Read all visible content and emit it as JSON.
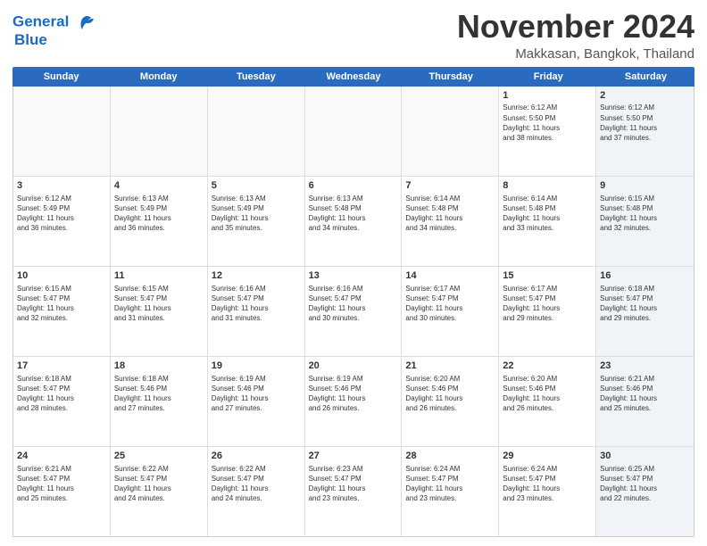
{
  "logo": {
    "line1": "General",
    "line2": "Blue"
  },
  "title": "November 2024",
  "location": "Makkasan, Bangkok, Thailand",
  "weekdays": [
    "Sunday",
    "Monday",
    "Tuesday",
    "Wednesday",
    "Thursday",
    "Friday",
    "Saturday"
  ],
  "weeks": [
    [
      {
        "day": "",
        "text": "",
        "empty": true
      },
      {
        "day": "",
        "text": "",
        "empty": true
      },
      {
        "day": "",
        "text": "",
        "empty": true
      },
      {
        "day": "",
        "text": "",
        "empty": true
      },
      {
        "day": "",
        "text": "",
        "empty": true
      },
      {
        "day": "1",
        "text": "Sunrise: 6:12 AM\nSunset: 5:50 PM\nDaylight: 11 hours\nand 38 minutes.",
        "empty": false,
        "shaded": false
      },
      {
        "day": "2",
        "text": "Sunrise: 6:12 AM\nSunset: 5:50 PM\nDaylight: 11 hours\nand 37 minutes.",
        "empty": false,
        "shaded": true
      }
    ],
    [
      {
        "day": "3",
        "text": "Sunrise: 6:12 AM\nSunset: 5:49 PM\nDaylight: 11 hours\nand 36 minutes.",
        "empty": false,
        "shaded": false
      },
      {
        "day": "4",
        "text": "Sunrise: 6:13 AM\nSunset: 5:49 PM\nDaylight: 11 hours\nand 36 minutes.",
        "empty": false,
        "shaded": false
      },
      {
        "day": "5",
        "text": "Sunrise: 6:13 AM\nSunset: 5:49 PM\nDaylight: 11 hours\nand 35 minutes.",
        "empty": false,
        "shaded": false
      },
      {
        "day": "6",
        "text": "Sunrise: 6:13 AM\nSunset: 5:48 PM\nDaylight: 11 hours\nand 34 minutes.",
        "empty": false,
        "shaded": false
      },
      {
        "day": "7",
        "text": "Sunrise: 6:14 AM\nSunset: 5:48 PM\nDaylight: 11 hours\nand 34 minutes.",
        "empty": false,
        "shaded": false
      },
      {
        "day": "8",
        "text": "Sunrise: 6:14 AM\nSunset: 5:48 PM\nDaylight: 11 hours\nand 33 minutes.",
        "empty": false,
        "shaded": false
      },
      {
        "day": "9",
        "text": "Sunrise: 6:15 AM\nSunset: 5:48 PM\nDaylight: 11 hours\nand 32 minutes.",
        "empty": false,
        "shaded": true
      }
    ],
    [
      {
        "day": "10",
        "text": "Sunrise: 6:15 AM\nSunset: 5:47 PM\nDaylight: 11 hours\nand 32 minutes.",
        "empty": false,
        "shaded": false
      },
      {
        "day": "11",
        "text": "Sunrise: 6:15 AM\nSunset: 5:47 PM\nDaylight: 11 hours\nand 31 minutes.",
        "empty": false,
        "shaded": false
      },
      {
        "day": "12",
        "text": "Sunrise: 6:16 AM\nSunset: 5:47 PM\nDaylight: 11 hours\nand 31 minutes.",
        "empty": false,
        "shaded": false
      },
      {
        "day": "13",
        "text": "Sunrise: 6:16 AM\nSunset: 5:47 PM\nDaylight: 11 hours\nand 30 minutes.",
        "empty": false,
        "shaded": false
      },
      {
        "day": "14",
        "text": "Sunrise: 6:17 AM\nSunset: 5:47 PM\nDaylight: 11 hours\nand 30 minutes.",
        "empty": false,
        "shaded": false
      },
      {
        "day": "15",
        "text": "Sunrise: 6:17 AM\nSunset: 5:47 PM\nDaylight: 11 hours\nand 29 minutes.",
        "empty": false,
        "shaded": false
      },
      {
        "day": "16",
        "text": "Sunrise: 6:18 AM\nSunset: 5:47 PM\nDaylight: 11 hours\nand 29 minutes.",
        "empty": false,
        "shaded": true
      }
    ],
    [
      {
        "day": "17",
        "text": "Sunrise: 6:18 AM\nSunset: 5:47 PM\nDaylight: 11 hours\nand 28 minutes.",
        "empty": false,
        "shaded": false
      },
      {
        "day": "18",
        "text": "Sunrise: 6:18 AM\nSunset: 5:46 PM\nDaylight: 11 hours\nand 27 minutes.",
        "empty": false,
        "shaded": false
      },
      {
        "day": "19",
        "text": "Sunrise: 6:19 AM\nSunset: 5:46 PM\nDaylight: 11 hours\nand 27 minutes.",
        "empty": false,
        "shaded": false
      },
      {
        "day": "20",
        "text": "Sunrise: 6:19 AM\nSunset: 5:46 PM\nDaylight: 11 hours\nand 26 minutes.",
        "empty": false,
        "shaded": false
      },
      {
        "day": "21",
        "text": "Sunrise: 6:20 AM\nSunset: 5:46 PM\nDaylight: 11 hours\nand 26 minutes.",
        "empty": false,
        "shaded": false
      },
      {
        "day": "22",
        "text": "Sunrise: 6:20 AM\nSunset: 5:46 PM\nDaylight: 11 hours\nand 26 minutes.",
        "empty": false,
        "shaded": false
      },
      {
        "day": "23",
        "text": "Sunrise: 6:21 AM\nSunset: 5:46 PM\nDaylight: 11 hours\nand 25 minutes.",
        "empty": false,
        "shaded": true
      }
    ],
    [
      {
        "day": "24",
        "text": "Sunrise: 6:21 AM\nSunset: 5:47 PM\nDaylight: 11 hours\nand 25 minutes.",
        "empty": false,
        "shaded": false
      },
      {
        "day": "25",
        "text": "Sunrise: 6:22 AM\nSunset: 5:47 PM\nDaylight: 11 hours\nand 24 minutes.",
        "empty": false,
        "shaded": false
      },
      {
        "day": "26",
        "text": "Sunrise: 6:22 AM\nSunset: 5:47 PM\nDaylight: 11 hours\nand 24 minutes.",
        "empty": false,
        "shaded": false
      },
      {
        "day": "27",
        "text": "Sunrise: 6:23 AM\nSunset: 5:47 PM\nDaylight: 11 hours\nand 23 minutes.",
        "empty": false,
        "shaded": false
      },
      {
        "day": "28",
        "text": "Sunrise: 6:24 AM\nSunset: 5:47 PM\nDaylight: 11 hours\nand 23 minutes.",
        "empty": false,
        "shaded": false
      },
      {
        "day": "29",
        "text": "Sunrise: 6:24 AM\nSunset: 5:47 PM\nDaylight: 11 hours\nand 23 minutes.",
        "empty": false,
        "shaded": false
      },
      {
        "day": "30",
        "text": "Sunrise: 6:25 AM\nSunset: 5:47 PM\nDaylight: 11 hours\nand 22 minutes.",
        "empty": false,
        "shaded": true
      }
    ]
  ]
}
